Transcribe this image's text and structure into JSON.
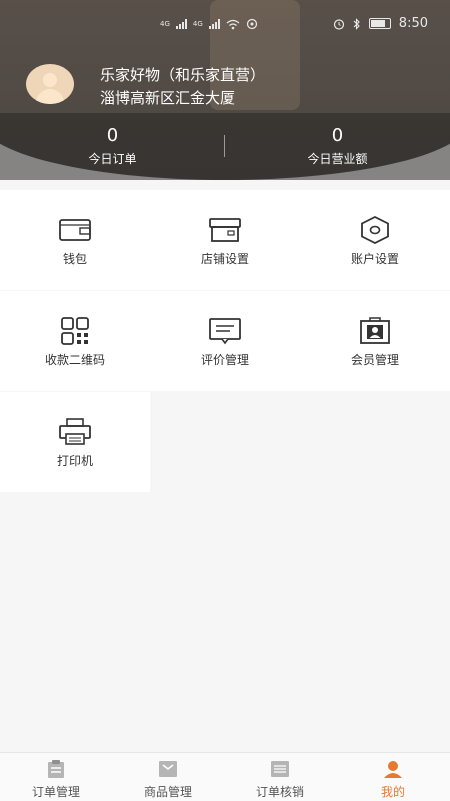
{
  "status_bar": {
    "carrier1": "4G",
    "carrier2": "4G",
    "time": "8:50"
  },
  "profile": {
    "store_name": "乐家好物（和乐家直营）",
    "address": "淄博高新区汇金大厦"
  },
  "stats": [
    {
      "value": "0",
      "label": "今日订单"
    },
    {
      "value": "0",
      "label": "今日营业额"
    }
  ],
  "menu": [
    {
      "label": "钱包",
      "icon": "wallet-icon"
    },
    {
      "label": "店铺设置",
      "icon": "store-icon"
    },
    {
      "label": "账户设置",
      "icon": "hexagon-settings-icon"
    },
    {
      "label": "收款二维码",
      "icon": "qrcode-icon"
    },
    {
      "label": "评价管理",
      "icon": "comment-icon"
    },
    {
      "label": "会员管理",
      "icon": "member-card-icon"
    },
    {
      "label": "打印机",
      "icon": "printer-icon"
    }
  ],
  "tabs": [
    {
      "label": "订单管理",
      "icon": "clipboard-icon",
      "active": false
    },
    {
      "label": "商品管理",
      "icon": "box-icon",
      "active": false
    },
    {
      "label": "订单核销",
      "icon": "scan-icon",
      "active": false
    },
    {
      "label": "我的",
      "icon": "user-icon",
      "active": true
    }
  ],
  "colors": {
    "accent": "#e8782e",
    "header": "#5e544c"
  }
}
